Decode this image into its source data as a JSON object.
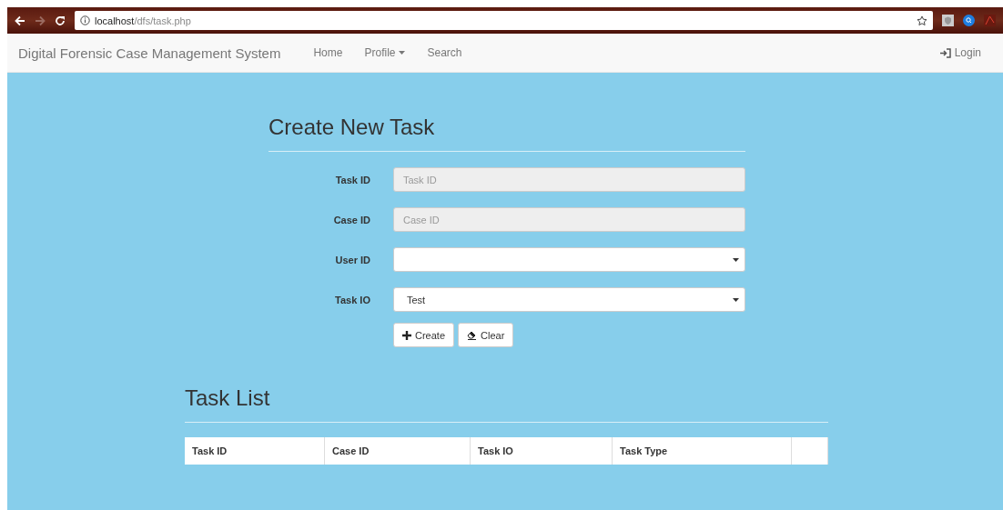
{
  "browser": {
    "url_host": "localhost",
    "url_path": "/dfs/task.php"
  },
  "navbar": {
    "brand": "Digital Forensic Case Management System",
    "items": [
      {
        "label": "Home",
        "dropdown": false
      },
      {
        "label": "Profile",
        "dropdown": true
      },
      {
        "label": "Search",
        "dropdown": false
      }
    ],
    "login": "Login"
  },
  "form": {
    "title": "Create New Task",
    "fields": [
      {
        "label": "Task ID",
        "kind": "text",
        "placeholder": "Task ID",
        "disabled": true
      },
      {
        "label": "Case ID",
        "kind": "text",
        "placeholder": "Case ID",
        "disabled": true
      },
      {
        "label": "User ID",
        "kind": "select"
      },
      {
        "label": "Task IO",
        "kind": "select",
        "value": "Test"
      }
    ],
    "buttons": [
      {
        "label": "Create",
        "kind": "create"
      },
      {
        "label": "Clear",
        "kind": "clear"
      }
    ]
  },
  "task_list": {
    "title": "Task List",
    "columns": [
      "Task ID",
      "Case ID",
      "Task IO",
      "Task Type"
    ]
  }
}
